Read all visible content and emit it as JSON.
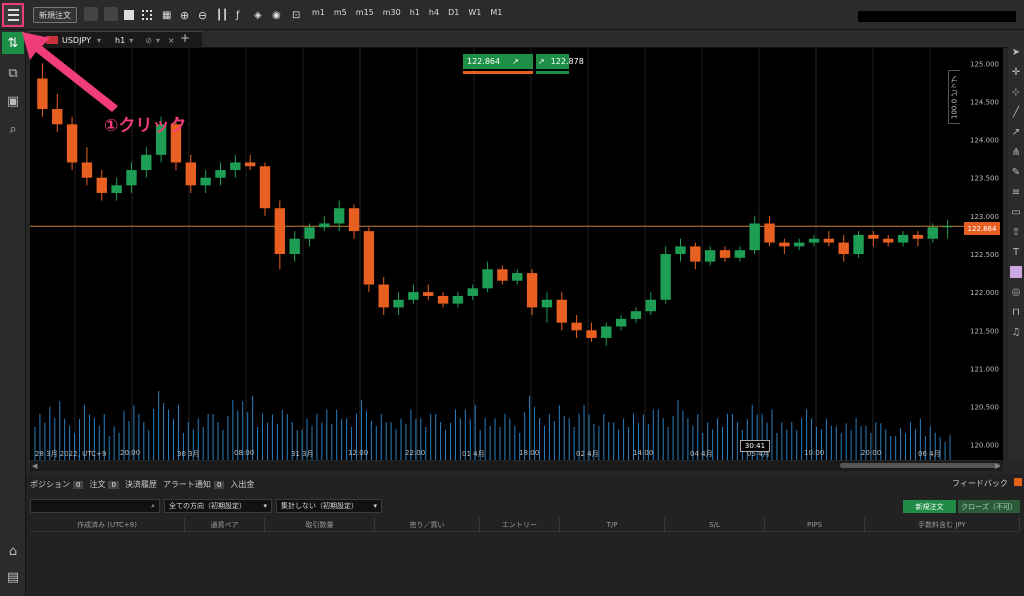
{
  "toolbar": {
    "new_order": "新規注文",
    "timeframes": [
      "m1",
      "m5",
      "m15",
      "m30",
      "h1",
      "h4",
      "D1",
      "W1",
      "M1"
    ]
  },
  "tab": {
    "symbol": "USDJPY",
    "timeframe": "h1"
  },
  "quote": {
    "bid": "122.864",
    "ask": "122.878",
    "bid_color": "#1e8f47",
    "ask_color": "#1e8f47"
  },
  "current_price_label": "122.864",
  "price_axis": [
    "125.000",
    "124.500",
    "124.000",
    "123.500",
    "123.000",
    "122.500",
    "122.000",
    "121.500",
    "121.000",
    "120.500",
    "120.000"
  ],
  "vertical_label": "100.0 ピップ",
  "time_axis": [
    "28 3月 2022, UTC+9",
    "20:00",
    "30 3月",
    "08:00",
    "31 3月",
    "12:00",
    "22:00",
    "01 4月",
    "18:00",
    "02 4月",
    "14:00",
    "04 4月",
    "05 4月",
    "10:00",
    "20:00",
    "06 4月"
  ],
  "countdown": "30:41",
  "annotation": "①クリック",
  "bottom": {
    "tabs": [
      {
        "label": "ポジション",
        "count": "0"
      },
      {
        "label": "注文",
        "count": "0"
      },
      {
        "label": "決済履歴",
        "count": ""
      },
      {
        "label": "アラート通知",
        "count": "0"
      },
      {
        "label": "入出金",
        "count": ""
      }
    ],
    "feedback": "フィードバック",
    "filter_direction": "全ての方向（初期設定）",
    "filter_aggregate": "集計しない（初期設定）",
    "new_order_btn": "新規注文",
    "close_btn": "クローズ（不可）",
    "columns": [
      "作成済み (UTC+8)",
      "通貨ペア",
      "取引数量",
      "売り／買い",
      "エントリー",
      "T/P",
      "S/L",
      "PIPS",
      "手数料含む JPY"
    ]
  },
  "colors": {
    "up": "#1e9e55",
    "down": "#e85f22",
    "price_line": "#c8803a",
    "volume": "#2a7fc0",
    "accent": "#f03c7a"
  },
  "chart_data": {
    "type": "candlestick",
    "ylim": [
      119.8,
      125.2
    ],
    "candles": [
      [
        124.8,
        125.0,
        124.3,
        124.4
      ],
      [
        124.4,
        124.6,
        124.1,
        124.2
      ],
      [
        124.2,
        124.3,
        123.6,
        123.7
      ],
      [
        123.7,
        123.9,
        123.4,
        123.5
      ],
      [
        123.5,
        123.6,
        123.2,
        123.3
      ],
      [
        123.3,
        123.5,
        123.2,
        123.4
      ],
      [
        123.4,
        123.7,
        123.3,
        123.6
      ],
      [
        123.6,
        123.9,
        123.5,
        123.8
      ],
      [
        123.8,
        124.3,
        123.7,
        124.2
      ],
      [
        124.2,
        124.3,
        123.6,
        123.7
      ],
      [
        123.7,
        123.8,
        123.3,
        123.4
      ],
      [
        123.4,
        123.6,
        123.3,
        123.5
      ],
      [
        123.5,
        123.7,
        123.4,
        123.6
      ],
      [
        123.6,
        123.8,
        123.5,
        123.7
      ],
      [
        123.7,
        123.8,
        123.6,
        123.65
      ],
      [
        123.65,
        123.7,
        123.0,
        123.1
      ],
      [
        123.1,
        123.2,
        122.3,
        122.5
      ],
      [
        122.5,
        122.8,
        122.4,
        122.7
      ],
      [
        122.7,
        122.9,
        122.6,
        122.85
      ],
      [
        122.85,
        123.0,
        122.8,
        122.9
      ],
      [
        122.9,
        123.2,
        122.8,
        123.1
      ],
      [
        123.1,
        123.15,
        122.7,
        122.8
      ],
      [
        122.8,
        122.85,
        122.0,
        122.1
      ],
      [
        122.1,
        122.2,
        121.7,
        121.8
      ],
      [
        121.8,
        122.0,
        121.7,
        121.9
      ],
      [
        121.9,
        122.1,
        121.85,
        122.0
      ],
      [
        122.0,
        122.1,
        121.9,
        121.95
      ],
      [
        121.95,
        122.0,
        121.8,
        121.85
      ],
      [
        121.85,
        122.0,
        121.8,
        121.95
      ],
      [
        121.95,
        122.1,
        121.9,
        122.05
      ],
      [
        122.05,
        122.4,
        122.0,
        122.3
      ],
      [
        122.3,
        122.35,
        122.1,
        122.15
      ],
      [
        122.15,
        122.3,
        122.1,
        122.25
      ],
      [
        122.25,
        122.3,
        121.7,
        121.8
      ],
      [
        121.8,
        122.0,
        121.6,
        121.9
      ],
      [
        121.9,
        122.0,
        121.5,
        121.6
      ],
      [
        121.6,
        121.7,
        121.4,
        121.5
      ],
      [
        121.5,
        121.6,
        121.35,
        121.4
      ],
      [
        121.4,
        121.6,
        121.3,
        121.55
      ],
      [
        121.55,
        121.7,
        121.5,
        121.65
      ],
      [
        121.65,
        121.8,
        121.6,
        121.75
      ],
      [
        121.75,
        122.0,
        121.7,
        121.9
      ],
      [
        121.9,
        122.6,
        121.85,
        122.5
      ],
      [
        122.5,
        122.7,
        122.4,
        122.6
      ],
      [
        122.6,
        122.65,
        122.3,
        122.4
      ],
      [
        122.4,
        122.6,
        122.35,
        122.55
      ],
      [
        122.55,
        122.6,
        122.4,
        122.45
      ],
      [
        122.45,
        122.6,
        122.4,
        122.55
      ],
      [
        122.55,
        123.0,
        122.5,
        122.9
      ],
      [
        122.9,
        123.0,
        122.6,
        122.65
      ],
      [
        122.65,
        122.7,
        122.5,
        122.6
      ],
      [
        122.6,
        122.7,
        122.55,
        122.65
      ],
      [
        122.65,
        122.75,
        122.6,
        122.7
      ],
      [
        122.7,
        122.8,
        122.6,
        122.65
      ],
      [
        122.65,
        122.75,
        122.4,
        122.5
      ],
      [
        122.5,
        122.8,
        122.45,
        122.75
      ],
      [
        122.75,
        122.8,
        122.6,
        122.7
      ],
      [
        122.7,
        122.75,
        122.6,
        122.65
      ],
      [
        122.65,
        122.8,
        122.6,
        122.75
      ],
      [
        122.75,
        122.8,
        122.6,
        122.7
      ],
      [
        122.7,
        122.9,
        122.65,
        122.85
      ],
      [
        122.85,
        122.95,
        122.7,
        122.864
      ]
    ],
    "volumes": [
      55,
      70,
      45,
      60,
      50,
      40,
      65,
      50,
      75,
      60,
      45,
      55,
      50,
      65,
      70,
      55,
      60,
      50,
      45,
      55,
      60,
      55,
      65,
      50,
      45,
      60,
      55,
      50,
      55,
      60,
      50,
      55,
      45,
      70,
      50,
      65,
      55,
      60,
      50,
      45,
      55,
      60,
      55,
      65,
      50,
      45,
      55,
      50,
      60,
      55,
      45,
      50,
      55,
      45,
      40,
      50,
      45,
      40,
      35,
      45,
      40,
      30
    ]
  }
}
